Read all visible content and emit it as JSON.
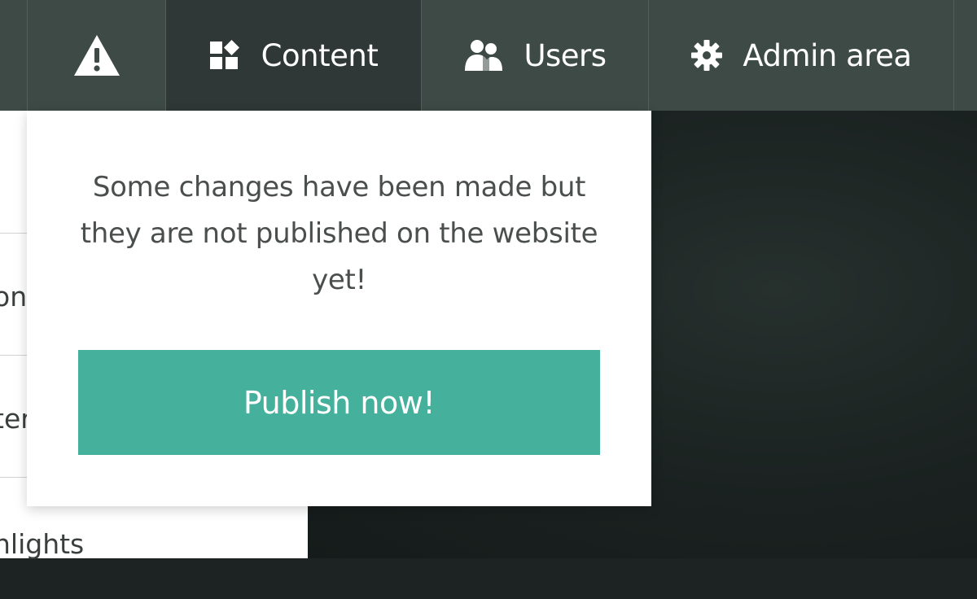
{
  "topbar": {
    "items": [
      {
        "label": "",
        "icon": "warning-icon",
        "active": false
      },
      {
        "label": "Content",
        "icon": "content-blocks-icon",
        "active": true
      },
      {
        "label": "Users",
        "icon": "users-icon",
        "active": false
      },
      {
        "label": "Admin area",
        "icon": "gear-icon",
        "active": false
      }
    ]
  },
  "side_list": {
    "items": [
      {
        "label": "on"
      },
      {
        "label": "ter"
      },
      {
        "label": "hlights"
      }
    ]
  },
  "popover": {
    "message": "Some changes have been made but they are not published on the website yet!",
    "button_label": "Publish now!"
  },
  "colors": {
    "topbar_bg": "#3d4a46",
    "topbar_active_bg": "#2f3836",
    "accent_green": "#45b09c",
    "text_dark": "#4a4f4e",
    "background_dark": "#1c2322"
  }
}
